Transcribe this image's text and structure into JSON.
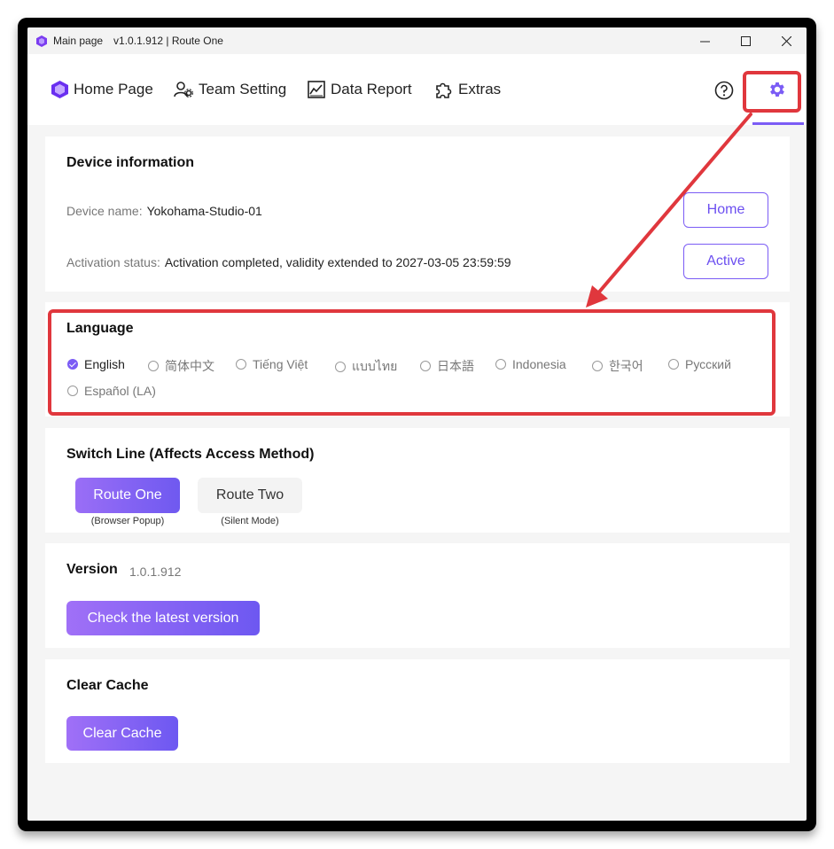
{
  "window": {
    "title": "Main page",
    "version_route": "v1.0.1.912 | Route One"
  },
  "nav": {
    "items": [
      {
        "label": "Home Page",
        "icon": "cube-logo-icon"
      },
      {
        "label": "Team Setting",
        "icon": "team-gear-icon"
      },
      {
        "label": "Data Report",
        "icon": "chart-icon"
      },
      {
        "label": "Extras",
        "icon": "puzzle-icon"
      }
    ],
    "active": "settings"
  },
  "device": {
    "title": "Device information",
    "name_label": "Device name:",
    "name_value": "Yokohama-Studio-01",
    "status_label": "Activation status:",
    "status_value": "Activation completed, validity extended to 2027-03-05 23:59:59",
    "home_button": "Home",
    "active_button": "Active"
  },
  "language": {
    "title": "Language",
    "options": [
      "English",
      "简体中文",
      "Tiếng Việt",
      "แบบไทย",
      "日本語",
      "Indonesia",
      "한국어",
      "Русский",
      "Español (LA)"
    ],
    "selected": "English"
  },
  "switch_line": {
    "title": "Switch Line (Affects Access Method)",
    "route_one": "Route One",
    "route_one_sub": "(Browser Popup)",
    "route_two": "Route Two",
    "route_two_sub": "(Silent Mode)"
  },
  "version": {
    "title": "Version",
    "number": "1.0.1.912",
    "check_button": "Check the latest version"
  },
  "cache": {
    "title": "Clear Cache",
    "button": "Clear Cache"
  },
  "colors": {
    "accent": "#7b5cf5",
    "annotation": "#e0373d"
  }
}
